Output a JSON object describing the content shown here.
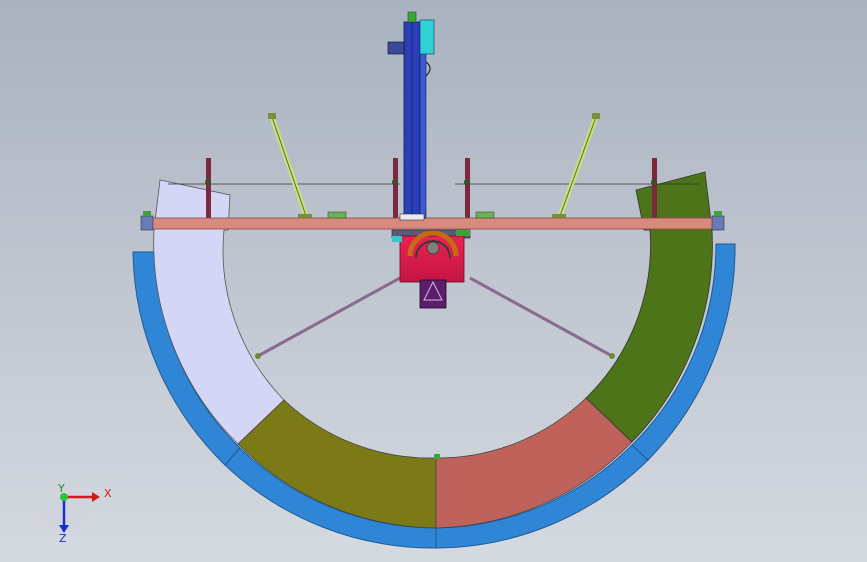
{
  "axes_triad": {
    "x_label": "X",
    "y_label": "Y",
    "z_label": "Z"
  },
  "colors": {
    "background_top": "#a9b2c0",
    "background_bottom": "#d5d9e0",
    "outer_ring": "#2f86d6",
    "segment_lavender": "#d4d6f5",
    "segment_olive": "#7b7a16",
    "segment_salmon": "#c0625c",
    "segment_green": "#4d7418",
    "cross_beam": "#d98a7e",
    "mast": "#2b3fb8",
    "hub": "#d91f4f",
    "strut": "#c7e27a",
    "tie_rod": "#8a6b8e",
    "post": "#7a2a3c"
  },
  "icons": {
    "axis_triad": "xyz-axis-triad-icon"
  }
}
